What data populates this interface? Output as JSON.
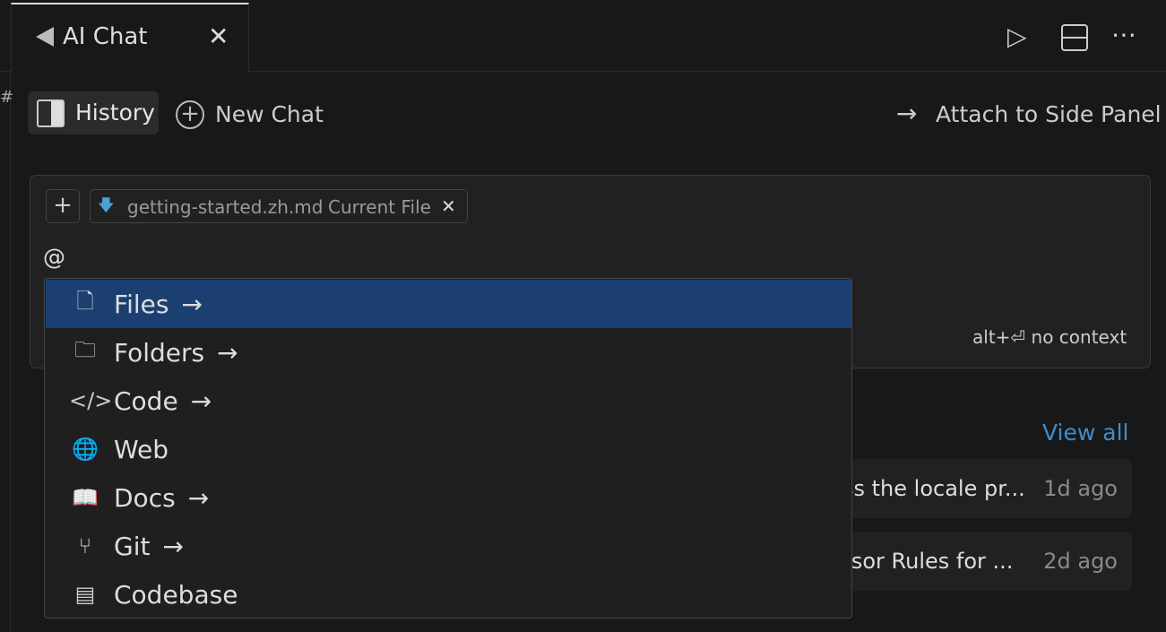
{
  "tab": {
    "title": "AI Chat",
    "close": "✕"
  },
  "actions": {
    "run": "▷",
    "split": "⊟",
    "more": "⋯"
  },
  "toolbar": {
    "history": "History",
    "new_chat": "New Chat",
    "attach": "Attach to Side Panel"
  },
  "input": {
    "add": "+",
    "chip_file": "getting-started.zh.md",
    "chip_label": "Current File",
    "chip_close": "✕",
    "value": "@",
    "hint": "alt+⏎ no context"
  },
  "menu": {
    "items": [
      {
        "label": "Files",
        "icon": "file-icon",
        "glyph": "🗋",
        "arrow": "→",
        "selected": true
      },
      {
        "label": "Folders",
        "icon": "folder-icon",
        "glyph": "🗀",
        "arrow": "→"
      },
      {
        "label": "Code",
        "icon": "code-icon",
        "glyph": "</>",
        "arrow": "→"
      },
      {
        "label": "Web",
        "icon": "globe-icon",
        "glyph": "🌐",
        "arrow": ""
      },
      {
        "label": "Docs",
        "icon": "book-icon",
        "glyph": "📖",
        "arrow": "→"
      },
      {
        "label": "Git",
        "icon": "git-branch-icon",
        "glyph": "⑂",
        "arrow": "→"
      },
      {
        "label": "Codebase",
        "icon": "repo-icon",
        "glyph": "▤",
        "arrow": ""
      }
    ]
  },
  "recent": {
    "view_all": "View all",
    "items": [
      {
        "title": "ss the locale pr...",
        "time": "1d ago"
      },
      {
        "title": "rsor Rules for ...",
        "time": "2d ago"
      }
    ]
  },
  "colors": {
    "accent": "#1c3f72",
    "link": "#3b8ed0"
  }
}
